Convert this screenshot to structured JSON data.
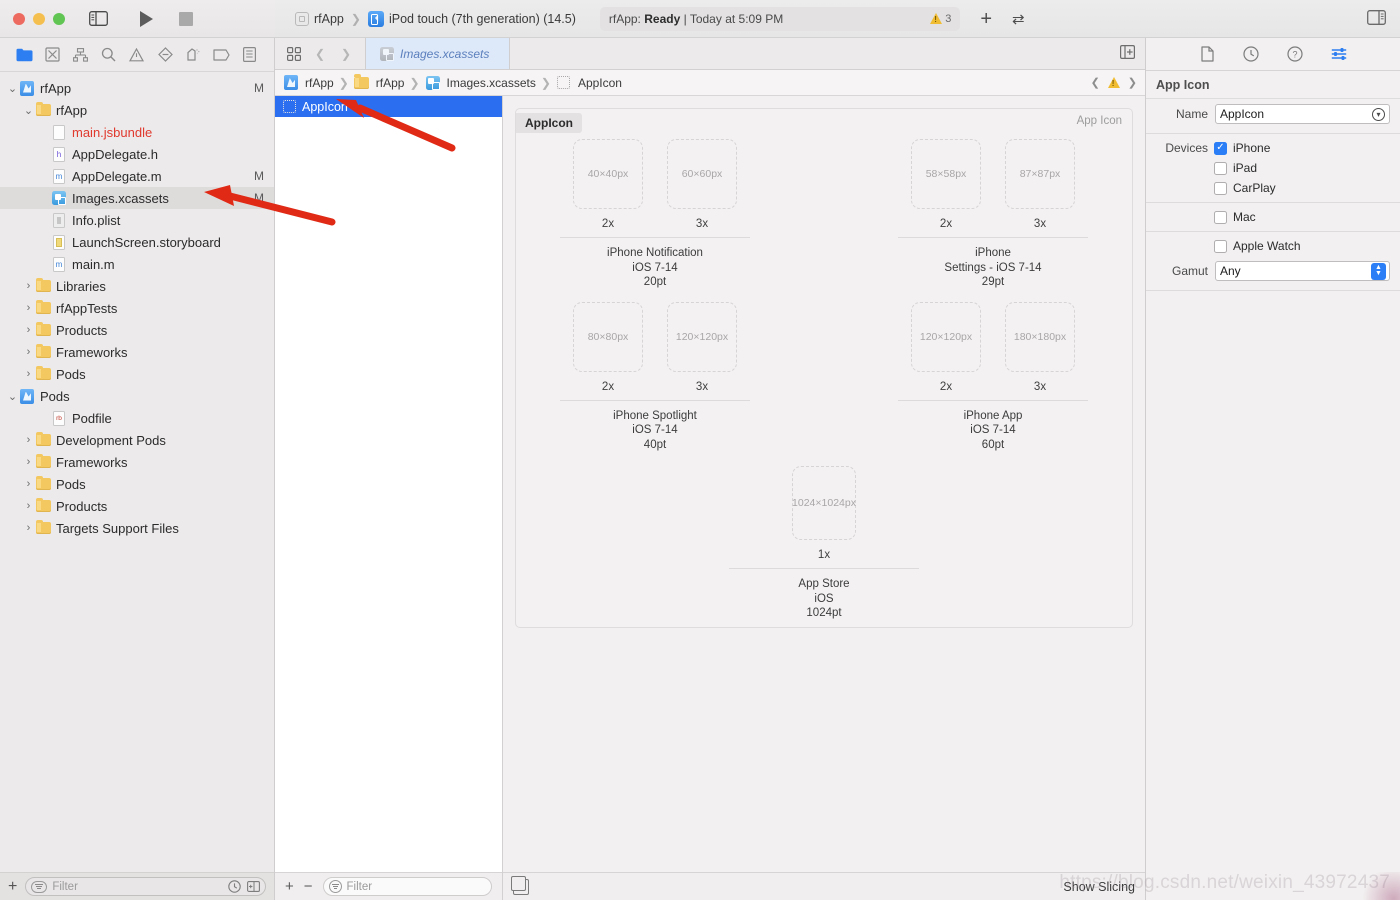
{
  "titlebar": {
    "scheme_project": "rfApp",
    "scheme_device": "iPod touch (7th generation) (14.5)",
    "status_prefix": "rfApp: ",
    "status_state": "Ready",
    "status_suffix": " | Today at 5:09 PM",
    "warning_count": "3",
    "add_label": "+",
    "swap_label": "⇄"
  },
  "navigator": {
    "toolbar_icons": [
      "folder-icon",
      "source-control-icon",
      "hierarchy-icon",
      "search-icon",
      "issue-icon",
      "test-icon",
      "debug-icon",
      "breakpoint-icon",
      "report-icon"
    ],
    "tree": [
      {
        "depth": 0,
        "twisty": "⌄",
        "icon": "project-icon",
        "label": "rfApp",
        "badge": "M",
        "selected": false
      },
      {
        "depth": 1,
        "twisty": "⌄",
        "icon": "folder-icon",
        "label": "rfApp",
        "badge": "",
        "selected": false
      },
      {
        "depth": 2,
        "twisty": "",
        "icon": "file-icon",
        "label": "main.jsbundle",
        "badge": "",
        "red": true,
        "selected": false
      },
      {
        "depth": 2,
        "twisty": "",
        "icon": "header-file-icon",
        "label": "AppDelegate.h",
        "badge": "",
        "selected": false
      },
      {
        "depth": 2,
        "twisty": "",
        "icon": "objc-file-icon",
        "label": "AppDelegate.m",
        "badge": "M",
        "selected": false
      },
      {
        "depth": 2,
        "twisty": "",
        "icon": "xcassets-icon",
        "label": "Images.xcassets",
        "badge": "M",
        "selected": true
      },
      {
        "depth": 2,
        "twisty": "",
        "icon": "plist-file-icon",
        "label": "Info.plist",
        "badge": "",
        "selected": false
      },
      {
        "depth": 2,
        "twisty": "",
        "icon": "storyboard-file-icon",
        "label": "LaunchScreen.storyboard",
        "badge": "",
        "selected": false
      },
      {
        "depth": 2,
        "twisty": "",
        "icon": "objc-file-icon",
        "label": "main.m",
        "badge": "",
        "selected": false
      },
      {
        "depth": 1,
        "twisty": "›",
        "icon": "folder-icon",
        "label": "Libraries",
        "badge": "",
        "selected": false
      },
      {
        "depth": 1,
        "twisty": "›",
        "icon": "folder-icon",
        "label": "rfAppTests",
        "badge": "",
        "selected": false
      },
      {
        "depth": 1,
        "twisty": "›",
        "icon": "folder-icon",
        "label": "Products",
        "badge": "",
        "selected": false
      },
      {
        "depth": 1,
        "twisty": "›",
        "icon": "folder-icon",
        "label": "Frameworks",
        "badge": "",
        "selected": false
      },
      {
        "depth": 1,
        "twisty": "›",
        "icon": "folder-icon",
        "label": "Pods",
        "badge": "",
        "selected": false
      },
      {
        "depth": 0,
        "twisty": "⌄",
        "icon": "project-icon",
        "label": "Pods",
        "badge": "",
        "selected": false
      },
      {
        "depth": 2,
        "twisty": "",
        "icon": "ruby-file-icon",
        "label": "Podfile",
        "badge": "",
        "selected": false
      },
      {
        "depth": 1,
        "twisty": "›",
        "icon": "folder-icon",
        "label": "Development Pods",
        "badge": "",
        "selected": false
      },
      {
        "depth": 1,
        "twisty": "›",
        "icon": "folder-icon",
        "label": "Frameworks",
        "badge": "",
        "selected": false
      },
      {
        "depth": 1,
        "twisty": "›",
        "icon": "folder-icon",
        "label": "Pods",
        "badge": "",
        "selected": false
      },
      {
        "depth": 1,
        "twisty": "›",
        "icon": "folder-icon",
        "label": "Products",
        "badge": "",
        "selected": false
      },
      {
        "depth": 1,
        "twisty": "›",
        "icon": "folder-icon",
        "label": "Targets Support Files",
        "badge": "",
        "selected": false
      }
    ],
    "filter_placeholder": "Filter",
    "add_label": "+"
  },
  "editor": {
    "tab_label": "Images.xcassets",
    "breadcrumb": [
      {
        "icon": "project-icon",
        "label": "rfApp"
      },
      {
        "icon": "folder-icon",
        "label": "rfApp"
      },
      {
        "icon": "xcassets-icon",
        "label": "Images.xcassets"
      },
      {
        "icon": "appicon-icon",
        "label": "AppIcon"
      }
    ],
    "asset_list": [
      {
        "icon": "appicon-icon",
        "label": "AppIcon",
        "selected": true
      }
    ],
    "asset_filter_placeholder": "Filter",
    "asset_add_label": "+",
    "asset_remove_label": "−",
    "show_slicing_label": "Show Slicing"
  },
  "icon_set": {
    "card_title": "AppIcon",
    "card_kind": "App Icon",
    "groups": [
      {
        "slots": [
          {
            "size": "40×40px",
            "scale": "2x"
          },
          {
            "size": "60×60px",
            "scale": "3x"
          }
        ],
        "caption_lines": [
          "iPhone Notification",
          "iOS 7-14",
          "20pt"
        ]
      },
      {
        "slots": [
          {
            "size": "58×58px",
            "scale": "2x"
          },
          {
            "size": "87×87px",
            "scale": "3x"
          }
        ],
        "caption_lines": [
          "iPhone",
          "Settings - iOS 7-14",
          "29pt"
        ]
      },
      {
        "slots": [
          {
            "size": "80×80px",
            "scale": "2x"
          },
          {
            "size": "120×120px",
            "scale": "3x"
          }
        ],
        "caption_lines": [
          "iPhone Spotlight",
          "iOS 7-14",
          "40pt"
        ]
      },
      {
        "slots": [
          {
            "size": "120×120px",
            "scale": "2x"
          },
          {
            "size": "180×180px",
            "scale": "3x"
          }
        ],
        "caption_lines": [
          "iPhone App",
          "iOS 7-14",
          "60pt"
        ]
      },
      {
        "slots": [
          {
            "size": "1024×1024px",
            "scale": "1x"
          }
        ],
        "caption_lines": [
          "App Store",
          "iOS",
          "1024pt"
        ]
      }
    ]
  },
  "inspector": {
    "toolbar_icons": [
      "file-inspector-icon",
      "history-inspector-icon",
      "help-inspector-icon",
      "attributes-inspector-icon"
    ],
    "title": "App Icon",
    "name_label": "Name",
    "name_value": "AppIcon",
    "devices_label": "Devices",
    "devices": [
      {
        "label": "iPhone",
        "checked": true
      },
      {
        "label": "iPad",
        "checked": false
      },
      {
        "label": "CarPlay",
        "checked": false
      },
      {
        "label": "Mac",
        "checked": false
      },
      {
        "label": "Apple Watch",
        "checked": false
      }
    ],
    "gamut_label": "Gamut",
    "gamut_value": "Any"
  },
  "watermark": {
    "text": "https://blog.csdn.net/weixin_43972437"
  },
  "colors": {
    "accent_blue": "#2b6ef0",
    "chrome_gray": "#eceaea",
    "canvas_gray": "#f2f0f0",
    "arrow_red": "#e02a16",
    "warning_yellow": "#f0bc32",
    "selected_row": "#2b6ef0"
  }
}
